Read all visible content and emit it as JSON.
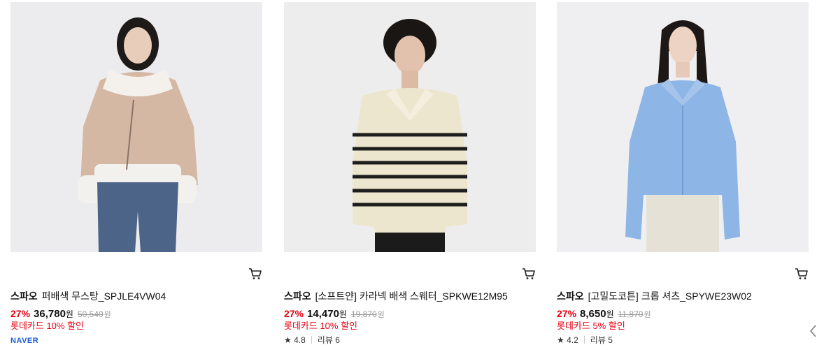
{
  "products": [
    {
      "brand": "스파오",
      "name": "퍼배색 무스탕_SPJLE4VW04",
      "discount": "27%",
      "price": "36,780",
      "price_unit": "원",
      "original_price": "50,540",
      "original_unit": "원",
      "card_discount": "롯데카드 10% 할인",
      "badge": "NAVER"
    },
    {
      "brand": "스파오",
      "name": "[소프트얀] 카라넥 배색 스웨터_SPKWE12M95",
      "discount": "27%",
      "price": "14,470",
      "price_unit": "원",
      "original_price": "19,870",
      "original_unit": "원",
      "card_discount": "롯데카드 10% 할인",
      "rating": "4.8",
      "reviews": "리뷰 6"
    },
    {
      "brand": "스파오",
      "name": "[고밀도코튼] 크롭 셔츠_SPYWE23W02",
      "discount": "27%",
      "price": "8,650",
      "price_unit": "원",
      "original_price": "11,870",
      "original_unit": "원",
      "card_discount": "롯데카드 5% 할인",
      "rating": "4.2",
      "reviews": "리뷰 5"
    }
  ],
  "colors": {
    "discount_red": "#e60012",
    "strike_gray": "#999999",
    "badge_blue": "#1a5bd6"
  },
  "icons": {
    "cart": "cart-icon",
    "star": "star-icon"
  }
}
